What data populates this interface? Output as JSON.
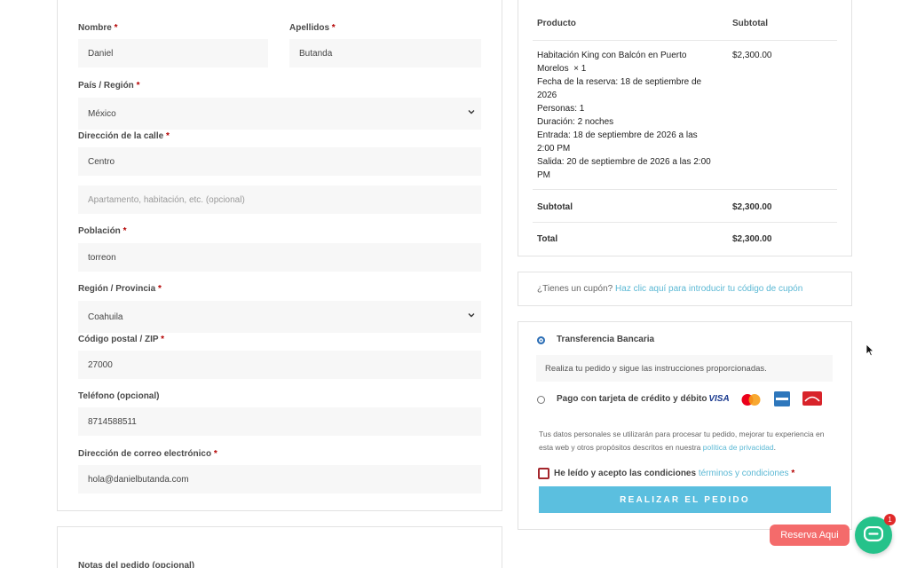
{
  "billing": {
    "first_name": {
      "label": "Nombre",
      "required": "*",
      "value": "Daniel"
    },
    "last_name": {
      "label": "Apellidos",
      "required": "*",
      "value": "Butanda"
    },
    "country": {
      "label": "País / Región",
      "required": "*",
      "value": "México"
    },
    "street": {
      "label": "Dirección de la calle",
      "required": "*",
      "value": "Centro"
    },
    "apartment": {
      "placeholder": "Apartamento, habitación, etc. (opcional)"
    },
    "city": {
      "label": "Población",
      "required": "*",
      "value": "torreon"
    },
    "state": {
      "label": "Región / Provincia",
      "required": "*",
      "value": "Coahuila"
    },
    "zip": {
      "label": "Código postal / ZIP",
      "required": "*",
      "value": "27000"
    },
    "phone": {
      "label": "Teléfono (opcional)",
      "value": "8714588511"
    },
    "email": {
      "label": "Dirección de correo electrónico",
      "required": "*",
      "value": "hola@danielbutanda.com"
    }
  },
  "notes": {
    "label": "Notas del pedido (opcional)"
  },
  "order": {
    "col_product": "Producto",
    "col_subtotal": "Subtotal",
    "item": {
      "name_line1": "Habitación King con Balcón en Puerto",
      "name_line2": "Morelos",
      "qty": "× 1",
      "price": "$2,300.00",
      "details": [
        "Fecha de la reserva: 18 de septiembre de",
        "2026",
        "Personas: 1",
        "Duración: 2 noches",
        "Entrada: 18 de septiembre de 2026 a las",
        "2:00 PM",
        "Salida: 20 de septiembre de 2026 a las 2:00",
        "PM"
      ]
    },
    "subtotal_label": "Subtotal",
    "subtotal_value": "$2,300.00",
    "total_label": "Total",
    "total_value": "$2,300.00"
  },
  "coupon": {
    "question": "¿Tienes un cupón?",
    "link": "Haz clic aquí para introducir tu código de cupón"
  },
  "payment": {
    "bank_transfer": {
      "label": "Transferencia Bancaria",
      "selected": true,
      "description": "Realiza tu pedido y sigue las instrucciones proporcionadas."
    },
    "card": {
      "label": "Pago con tarjeta de crédito y débito",
      "selected": false,
      "logos": [
        "VISA",
        "mastercard",
        "amex",
        "carnet"
      ]
    },
    "privacy_line1": "Tus datos personales se utilizarán para procesar tu pedido, mejorar tu experiencia en",
    "privacy_line2_prefix": "esta web y otros propósitos descritos en nuestra",
    "privacy_link": "política de privacidad",
    "privacy_suffix": ".",
    "terms_prefix": "He leído y acepto las condiciones",
    "terms_link": "términos y condiciones",
    "terms_required": "*",
    "place_order": "REALIZAR EL PEDIDO"
  },
  "chat": {
    "label": "Reserva Aqui",
    "badge": "1"
  },
  "colors": {
    "accent": "#5bbfdf",
    "required": "#b40000",
    "chat_pill": "#f46b6b",
    "chat_fab": "#25c28a"
  }
}
